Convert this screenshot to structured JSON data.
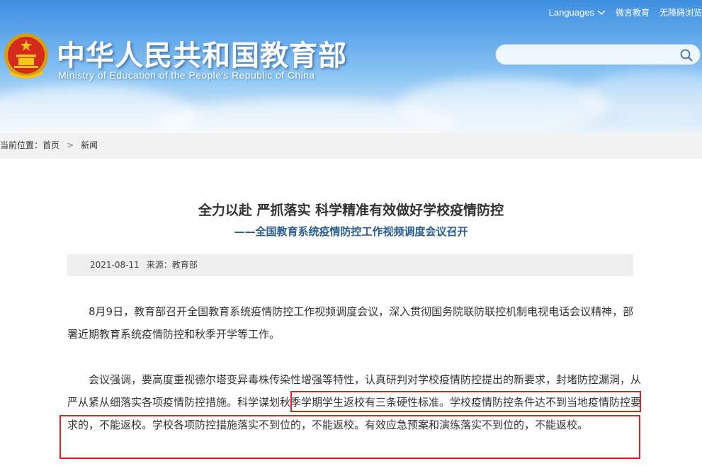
{
  "header": {
    "title_cn": "中华人民共和国教育部",
    "title_en": "Ministry of Education of the People's Republic of China",
    "links": {
      "languages": "Languages",
      "weiyan": "微言教育",
      "accessibility": "无障碍浏览"
    },
    "search": {
      "value": "",
      "placeholder": ""
    }
  },
  "breadcrumb": {
    "prefix": "当前位置：",
    "home": "首页",
    "separator": ">",
    "current": "新闻"
  },
  "article": {
    "title": "全力以赴 严抓落实 科学精准有效做好学校疫情防控",
    "subtitle": "——全国教育系统疫情防控工作视频调度会议召开",
    "date": "2021-08-11",
    "source_label": "来源：",
    "source": "教育部",
    "paragraph1": "8月9日，教育部召开全国教育系统疫情防控工作视频调度会议，深入贯彻国务院联防联控机制电视电话会议精神，部署近期教育系统疫情防控和秋季开学等工作。",
    "paragraph2": "会议强调，要高度重视德尔塔变异毒株传染性增强等特性，认真研判对学校疫情防控提出的新要求，封堵防控漏洞，从严从紧从细落实各项疫情防控措施。科学谋划秋季学期学生返校有三条硬性标准。学校疫情防控条件达不到当地疫情防控要求的，不能返校。学校各项防控措施落实不到位的，不能返校。有效应急预案和演练落实不到位的，不能返校。"
  },
  "colors": {
    "header_top": "#3f8fe0",
    "header_bottom": "#e9f3fb",
    "subtitle": "#2a5d92",
    "highlight_border": "#e02020",
    "meta_bg": "#eeeeee"
  },
  "icons": [
    "national-emblem-icon",
    "chevron-down-icon",
    "search-icon"
  ]
}
